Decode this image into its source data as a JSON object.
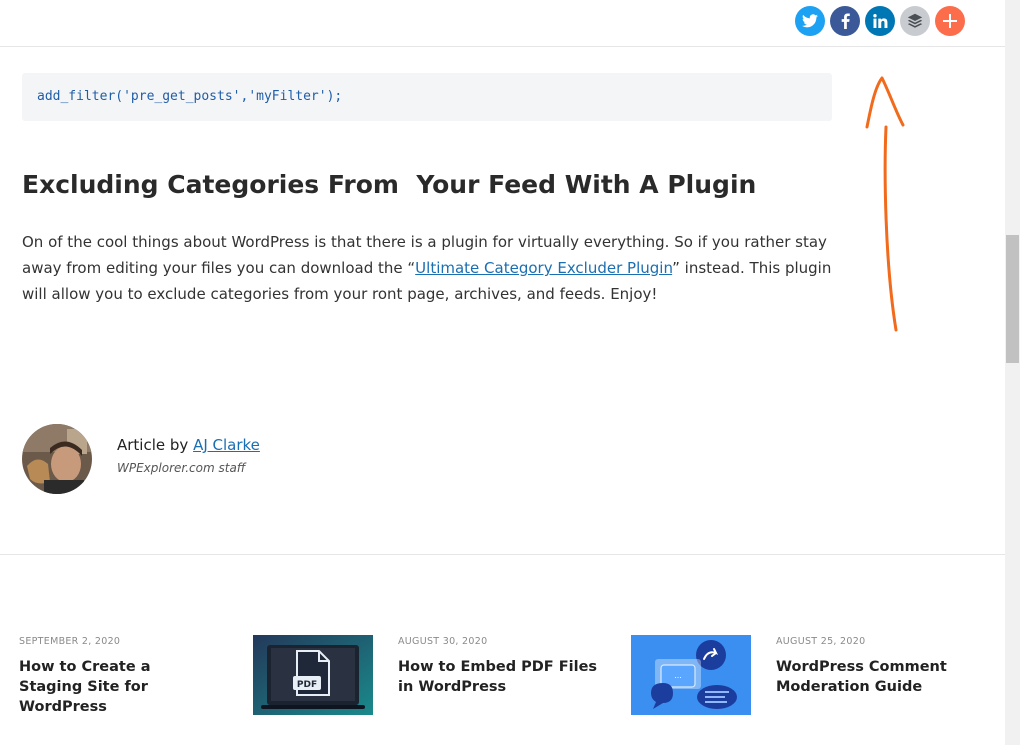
{
  "share": [
    {
      "name": "twitter",
      "icon": "twitter-icon",
      "color": "#1da1f2"
    },
    {
      "name": "facebook",
      "icon": "facebook-icon",
      "color": "#3b5998"
    },
    {
      "name": "linkedin",
      "icon": "linkedin-icon",
      "color": "#0077b5"
    },
    {
      "name": "buffer",
      "icon": "layers-icon",
      "color": "#c8ccd0"
    },
    {
      "name": "more",
      "icon": "plus-icon",
      "color": "#fc6d4c"
    }
  ],
  "code_line": "add_filter('pre_get_posts','myFilter');",
  "section_heading": "Excluding Categories From  Your Feed With A Plugin",
  "paragraph": {
    "before": "On of the cool things about WordPress is that there is a plugin for virtually everything. So if you rather stay away from editing your files you can download the “",
    "link": "Ultimate Category Excluder Plugin",
    "after": "” instead. This plugin will allow you to exclude categories from your ront page, archives, and feeds. Enjoy!"
  },
  "author": {
    "prefix": "Article by ",
    "name": "AJ Clarke",
    "role": "WPExplorer.com staff"
  },
  "related": [
    {
      "date": "SEPTEMBER 2, 2020",
      "title": "How to Create a Staging Site for WordPress"
    },
    {
      "date": "AUGUST 30, 2020",
      "title": "How to Embed PDF Files in WordPress",
      "thumb_label": "PDF"
    },
    {
      "date": "AUGUST 25, 2020",
      "title": "WordPress Comment Moderation Guide",
      "thumb_label": "..."
    }
  ],
  "colors": {
    "link": "#1a6fb3",
    "annotation": "#f26a1b"
  }
}
